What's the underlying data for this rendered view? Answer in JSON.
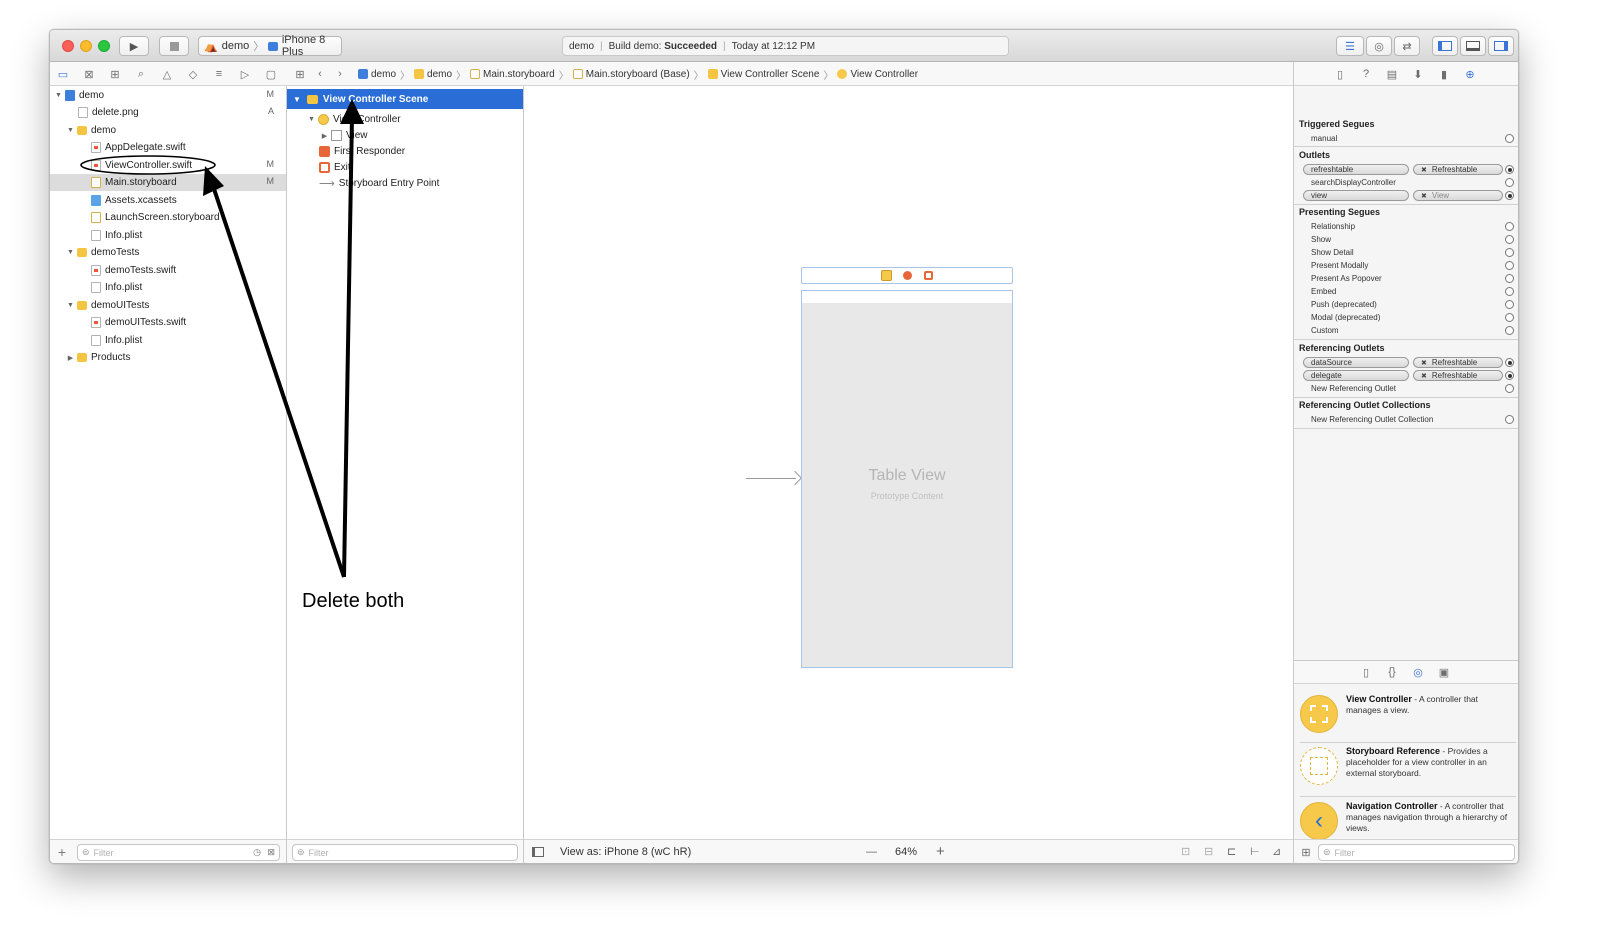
{
  "toolbar": {
    "scheme": "demo",
    "device": "iPhone 8 Plus",
    "activity_project": "demo",
    "activity_action": "Build demo:",
    "activity_status": "Succeeded",
    "activity_time": "Today at 12:12 PM"
  },
  "breadcrumbs": [
    "demo",
    "demo",
    "Main.storyboard",
    "Main.storyboard (Base)",
    "View Controller Scene",
    "View Controller"
  ],
  "navigator": {
    "items": [
      {
        "label": "demo",
        "badge": "M"
      },
      {
        "label": "delete.png",
        "badge": "A"
      },
      {
        "label": "demo",
        "badge": ""
      },
      {
        "label": "AppDelegate.swift",
        "badge": ""
      },
      {
        "label": "ViewController.swift",
        "badge": "M"
      },
      {
        "label": "Main.storyboard",
        "badge": "M"
      },
      {
        "label": "Assets.xcassets",
        "badge": ""
      },
      {
        "label": "LaunchScreen.storyboard",
        "badge": ""
      },
      {
        "label": "Info.plist",
        "badge": ""
      },
      {
        "label": "demoTests",
        "badge": ""
      },
      {
        "label": "demoTests.swift",
        "badge": ""
      },
      {
        "label": "Info.plist",
        "badge": ""
      },
      {
        "label": "demoUITests",
        "badge": ""
      },
      {
        "label": "demoUITests.swift",
        "badge": ""
      },
      {
        "label": "Info.plist",
        "badge": ""
      },
      {
        "label": "Products",
        "badge": ""
      }
    ],
    "filter_placeholder": "Filter"
  },
  "outline": {
    "scene": "View Controller Scene",
    "items": [
      "View Controller",
      "View",
      "First Responder",
      "Exit",
      "Storyboard Entry Point"
    ],
    "filter_placeholder": "Filter"
  },
  "canvas": {
    "table_title": "Table View",
    "table_subtitle": "Prototype Content",
    "view_as": "View as: iPhone 8 (wC hR)",
    "zoom": "64%",
    "zoom_minus": "—",
    "zoom_plus": "+"
  },
  "inspector": {
    "triggered_title": "Triggered Segues",
    "triggered": [
      "manual"
    ],
    "outlets_title": "Outlets",
    "outlets": [
      {
        "name": "refreshtable",
        "target": "Refreshtable",
        "connected": true
      },
      {
        "name": "searchDisplayController",
        "target": "",
        "connected": false
      },
      {
        "name": "view",
        "target": "View",
        "connected": true
      }
    ],
    "presenting_title": "Presenting Segues",
    "presenting": [
      "Relationship",
      "Show",
      "Show Detail",
      "Present Modally",
      "Present As Popover",
      "Embed",
      "Push (deprecated)",
      "Modal (deprecated)",
      "Custom"
    ],
    "referencing_title": "Referencing Outlets",
    "referencing": [
      {
        "name": "dataSource",
        "target": "Refreshtable"
      },
      {
        "name": "delegate",
        "target": "Refreshtable"
      }
    ],
    "new_referencing": "New Referencing Outlet",
    "collections_title": "Referencing Outlet Collections",
    "new_collection": "New Referencing Outlet Collection"
  },
  "library": {
    "items": [
      {
        "title": "View Controller",
        "desc": " - A controller that manages a view."
      },
      {
        "title": "Storyboard Reference",
        "desc": " - Provides a placeholder for a view controller in an external storyboard."
      },
      {
        "title": "Navigation Controller",
        "desc": " - A controller that manages navigation through a hierarchy of views."
      }
    ],
    "filter_placeholder": "Filter"
  },
  "annotation": {
    "text": "Delete both"
  },
  "colors": {
    "selection_blue": "#2a6dd6",
    "traffic_red": "#fc5f57",
    "traffic_yellow": "#fdbc2e",
    "traffic_green": "#29c840",
    "library_yellow": "#f6c94a"
  }
}
